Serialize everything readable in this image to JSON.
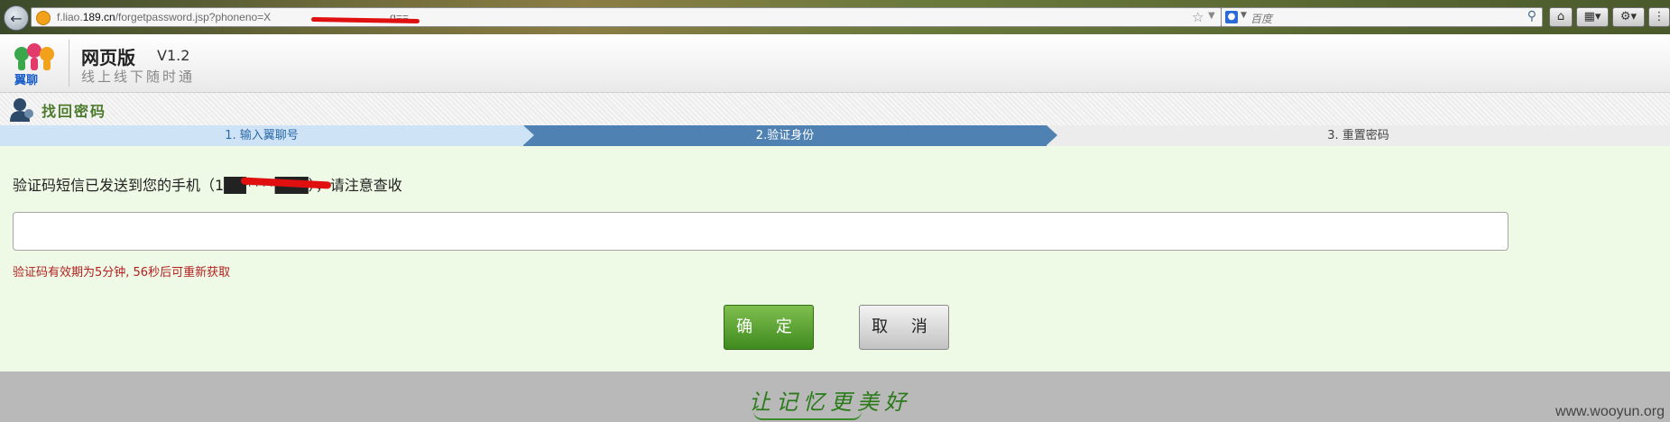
{
  "browser": {
    "url_prefix": "f.liao.",
    "url_domain": "189.cn",
    "url_path": "/forgetpassword.jsp?phoneno=X",
    "url_tail": "g==",
    "search_placeholder": "百度"
  },
  "header": {
    "logo_text": "翼聊",
    "title": "网页版",
    "version": "V1.2",
    "slogan": "线上线下随时通"
  },
  "section": {
    "title": "找回密码"
  },
  "steps": [
    {
      "label": "1. 输入翼聊号"
    },
    {
      "label": "2.验证身份"
    },
    {
      "label": "3. 重置密码"
    }
  ],
  "form": {
    "message_prefix": "验证码短信已发送到您的手机（",
    "phone_masked": "1██****███",
    "message_suffix": "），请注意查收",
    "code_value": "",
    "expiry_note": "验证码有效期为5分钟, 56秒后可重新获取",
    "confirm_label": "确 定",
    "cancel_label": "取 消"
  },
  "footer": {
    "slogan": "让记忆更美好",
    "watermark": "www.wooyun.org"
  },
  "colors": {
    "step_active": "#4f82b3",
    "step_done": "#cfe3f6",
    "content_bg": "#eef9e6",
    "confirm_green": "#3f8a1f",
    "error_red": "#b32020"
  }
}
